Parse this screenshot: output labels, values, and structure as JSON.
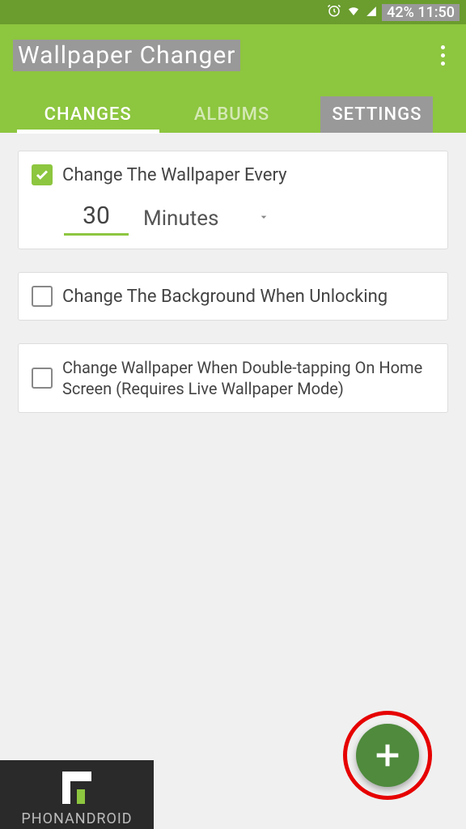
{
  "status_bar": {
    "battery_time": "42% 11:50"
  },
  "header": {
    "title": "Wallpaper Changer"
  },
  "tabs": {
    "changes": "CHANGES",
    "albums": "ALBUMS",
    "settings": "SETTINGS"
  },
  "options": {
    "change_every": {
      "checked": true,
      "label": "Change The Wallpaper Every",
      "value": "30",
      "unit": "Minutes"
    },
    "change_unlock": {
      "checked": false,
      "label": "Change The Background When Unlocking"
    },
    "change_double_tap": {
      "checked": false,
      "label": "Change Wallpaper When Double-tapping On Home Screen (Requires Live Wallpaper Mode)"
    }
  },
  "watermark": {
    "text": "PHONANDROID"
  }
}
